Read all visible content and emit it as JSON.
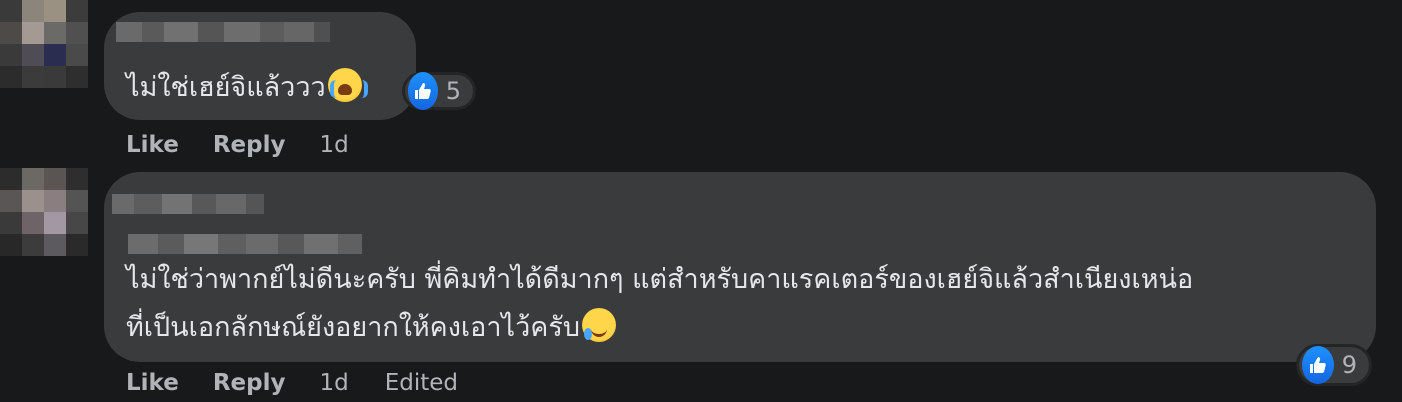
{
  "comments": [
    {
      "text_lines": [
        "ไม่ใช่เฮย์จิแล้ววว"
      ],
      "emoji": "loudly-crying-face-icon",
      "reaction": {
        "icon": "thumbs-up-icon",
        "count": "5"
      },
      "actions": {
        "like": "Like",
        "reply": "Reply",
        "time": "1d"
      }
    },
    {
      "text_lines": [
        "ไม่ใช่ว่าพากย์ไม่ดีนะครับ พี่คิมทำได้ดีมากๆ แต่สำหรับคาแรคเตอร์ของเฮย์จิแล้วสำเนียงเหน่อ",
        "ที่เป็นเอกลักษณ์ยังอยากให้คงเอาไว้ครับ"
      ],
      "emoji": "face-holding-back-tears-icon",
      "reaction": {
        "icon": "thumbs-up-icon",
        "count": "9"
      },
      "actions": {
        "like": "Like",
        "reply": "Reply",
        "time": "1d",
        "edited": "Edited"
      }
    }
  ],
  "colors": {
    "background": "#18191a",
    "bubble": "#3a3b3c",
    "like_blue": "#1877f2",
    "secondary_text": "#b0b3b8"
  }
}
